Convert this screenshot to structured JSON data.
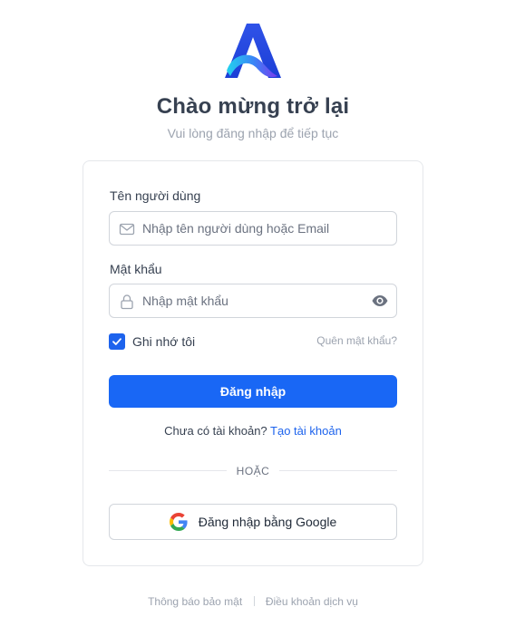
{
  "header": {
    "title": "Chào mừng trở lại",
    "subtitle": "Vui lòng đăng nhập để tiếp tục"
  },
  "form": {
    "username_label": "Tên người dùng",
    "username_placeholder": "Nhập tên người dùng hoặc Email",
    "username_value": "",
    "password_label": "Mật khẩu",
    "password_placeholder": "Nhập mật khẩu",
    "password_value": "",
    "remember_label": "Ghi nhớ tôi",
    "remember_checked": true,
    "forgot_label": "Quên mật khẩu?",
    "submit_label": "Đăng nhập",
    "signup_prompt": "Chưa có tài khoản?",
    "signup_link": "Tạo tài khoản",
    "or_label": "HOẶC",
    "google_label": "Đăng nhập bằng Google"
  },
  "footer": {
    "privacy_label": "Thông báo bảo mật",
    "terms_label": "Điều khoản dịch vụ"
  },
  "colors": {
    "primary": "#1967f5",
    "link": "#1d63ed",
    "muted": "#9ca3af"
  },
  "icons": {
    "logo": "brand-logo-a",
    "username": "mail-icon",
    "password": "lock-icon",
    "toggle": "eye-icon",
    "remember": "check-icon",
    "google": "google-icon"
  }
}
